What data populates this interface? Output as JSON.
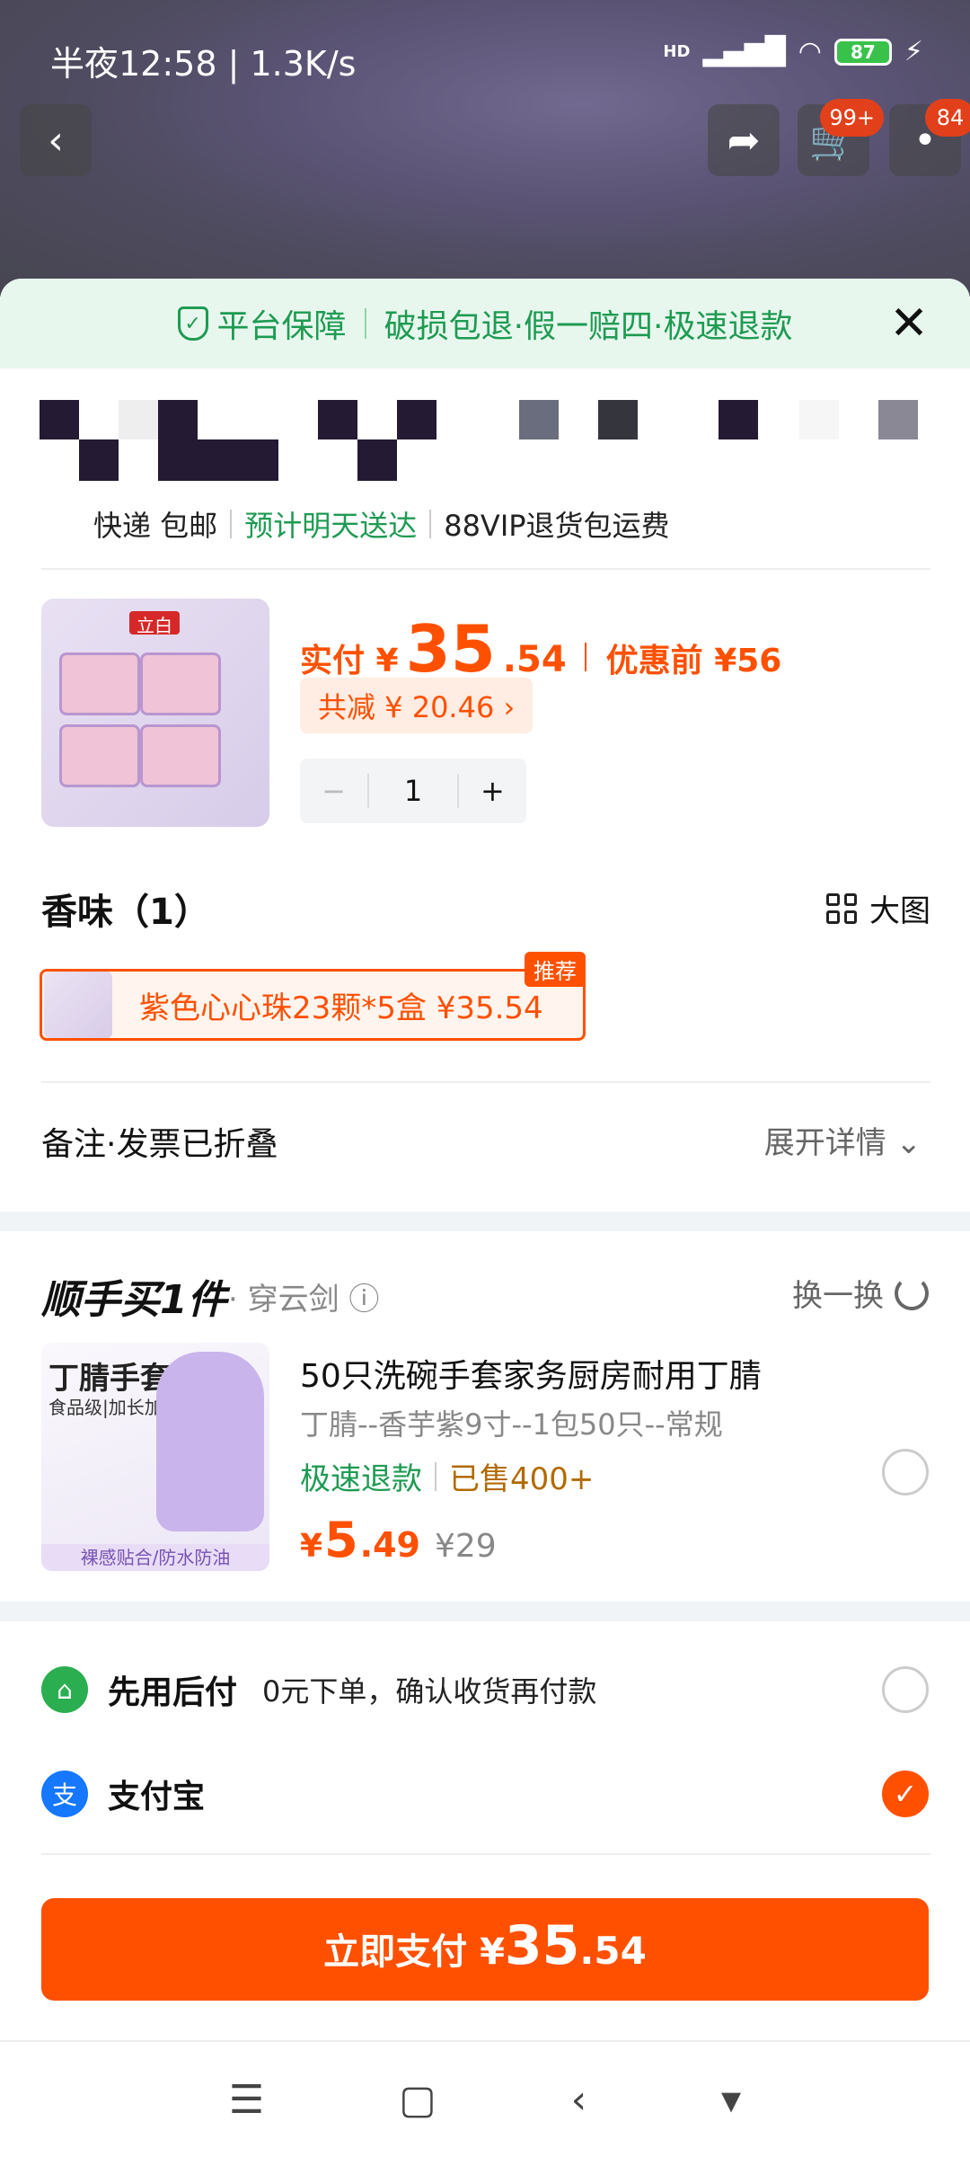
{
  "status_bar": {
    "time": "半夜12:58 | 1.3K/s",
    "battery": "87",
    "signal": "HD"
  },
  "top_bar": {
    "cart_badge": "99+",
    "msg_badge": "84"
  },
  "guarantee": {
    "label": "平台保障",
    "items": "破损包退·假一赔四·极速退款"
  },
  "shipping": {
    "method": "快递 包邮",
    "eta": "预计明天送达",
    "vip": "88VIP退货包运费"
  },
  "product": {
    "brand_logo": "立白",
    "price_label": "实付 ¥",
    "price_int": "35",
    "price_dec": ".54",
    "price_before": "优惠前 ¥56",
    "reduce": "共减 ¥ 20.46 ›",
    "qty_minus": "−",
    "qty": "1",
    "qty_plus": "+"
  },
  "scent": {
    "title": "香味（1）",
    "big_view": "大图",
    "option": "紫色心心珠23颗*5盒  ¥35.54",
    "rec_badge": "推荐"
  },
  "remark": {
    "label": "备注·发票已折叠",
    "expand": "展开详情 ⌄"
  },
  "addon": {
    "title": "顺手买1件",
    "subtitle": "· 穿云剑 ⓘ",
    "swap": "换一换",
    "img_title": "丁腈手套",
    "img_sub": "食品级|加长加厚",
    "img_foot": "裸感贴合/防水防油",
    "name": "50只洗碗手套家务厨房耐用丁腈",
    "spec": "丁腈--香芋紫9寸--1包50只--常规",
    "tag_refund": "极速退款",
    "tag_sold": "已售400+",
    "price_sym": "¥",
    "price_int": "5",
    "price_dec": ".49",
    "price_orig": "¥29"
  },
  "payment": {
    "later_name": "先用后付",
    "later_desc": "0元下单，确认收货再付款",
    "alipay_name": "支付宝"
  },
  "pay_button": {
    "label": "立即支付 ¥",
    "int": "35",
    "dec": ".54"
  },
  "colors": {
    "accent": "#ff5000",
    "green": "#1e9b52",
    "alipay": "#1677ff"
  }
}
